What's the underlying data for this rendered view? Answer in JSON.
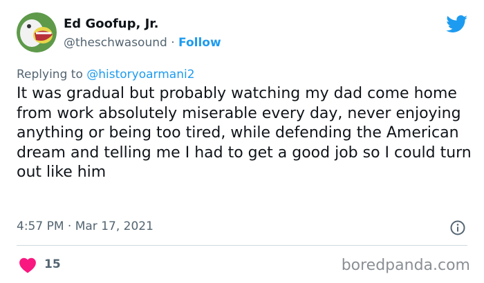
{
  "author": {
    "display_name": "Ed Goofup, Jr.",
    "handle": "@theschwasound",
    "separator": "·",
    "follow_label": "Follow",
    "avatar_icon": "cartoon-face-avatar"
  },
  "reply": {
    "prefix": "Replying to",
    "mention": "@historyoarmani2"
  },
  "tweet": {
    "text": "It was gradual but probably watching my dad come home from work absolutely miserable every day, never enjoying anything or being too tired, while defending the American dream and telling me I had to get a good job so I could turn out like him",
    "timestamp": "4:57 PM · Mar 17, 2021"
  },
  "engagement": {
    "likes": "15"
  },
  "watermark": "boredpanda.com",
  "icons": {
    "brand": "twitter-bird-icon",
    "info": "info-icon",
    "like": "heart-icon"
  },
  "colors": {
    "accent": "#1d9bf0",
    "like": "#f91880",
    "text": "#0f1419",
    "muted": "#536471"
  }
}
